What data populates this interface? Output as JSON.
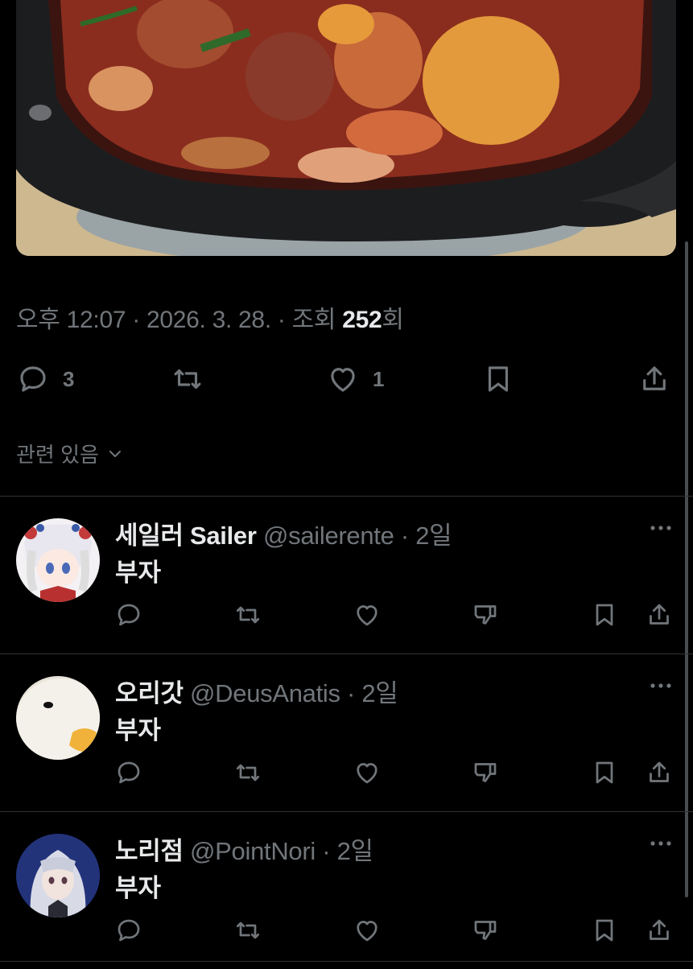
{
  "post": {
    "image_alt": "spicy braised chicken stew",
    "meta": {
      "time": "오후 12:07",
      "sep1": " · ",
      "date": "2026. 3. 28.",
      "sep2": " · ",
      "views_prefix": "조회 ",
      "views": "252",
      "views_suffix": "회"
    },
    "actions": {
      "reply_count": "3",
      "repost_count": "",
      "like_count": "1"
    },
    "related_label": "관련 있음"
  },
  "replies": [
    {
      "name": "세일러 Sailer",
      "handle": "@sailerente",
      "time": " · 2일",
      "text": "부자",
      "avatar": "anime-girl-white-hair-avatar"
    },
    {
      "name": "오리갓",
      "handle": "@DeusAnatis",
      "time": " · 2일",
      "text": "부자",
      "avatar": "white-duck-avatar"
    },
    {
      "name": "노리점",
      "handle": "@PointNori",
      "time": " · 2일",
      "text": "부자",
      "avatar": "silver-hair-character-avatar"
    }
  ],
  "colors": {
    "background": "#000000",
    "text": "#e7e9ea",
    "muted": "#71767b",
    "divider": "#2f3336"
  }
}
